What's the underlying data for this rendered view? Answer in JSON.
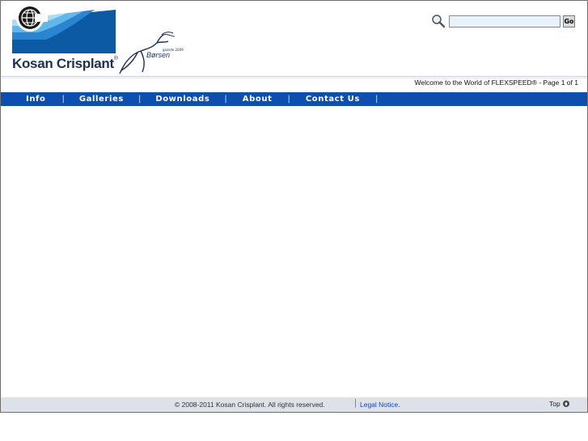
{
  "header": {
    "brand_name": "Kosan Crisplant",
    "brand_mark": "®",
    "award_logo_text": "Børsen",
    "award_logo_year": "gazelle 2009",
    "icons": {
      "logo": "kosan-crisplant-logo",
      "award": "borsen-gazelle-logo",
      "search": "magnifier-icon"
    }
  },
  "search": {
    "value": "",
    "placeholder": "",
    "button_label": "Go"
  },
  "status": {
    "welcome_text": "Welcome to the World of FLEXSPEED® - Page 1 of 1"
  },
  "nav": {
    "items": [
      {
        "label": "Info"
      },
      {
        "label": "Galleries"
      },
      {
        "label": "Downloads"
      },
      {
        "label": "About"
      },
      {
        "label": "Contact Us"
      }
    ],
    "separator": "|"
  },
  "footer": {
    "copyright": "© 2008-2011 Kosan Crisplant. All rights reserved.",
    "separator": "|",
    "legal_label": "Legal Notice",
    "legal_dot": ".",
    "top_label": "Top",
    "top_icon": "arrow-up-circle-icon"
  },
  "colors": {
    "nav_bg": "#0c4fae",
    "footer_bg": "#dde2e8",
    "brand": "#1c2f57",
    "link": "#1b3fb8"
  }
}
